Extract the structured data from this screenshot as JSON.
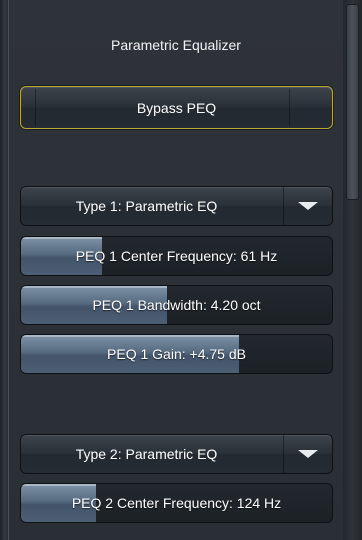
{
  "title": "Parametric Equalizer",
  "bypass_label": "Bypass PEQ",
  "peq1": {
    "type_label": "Type 1: Parametric EQ",
    "center_freq_label": "PEQ 1 Center Frequency: 61 Hz",
    "center_freq_level": 0.26,
    "bandwidth_label": "PEQ 1 Bandwidth: 4.20 oct",
    "bandwidth_level": 0.47,
    "gain_label": "PEQ 1 Gain: +4.75 dB",
    "gain_level": 0.7
  },
  "peq2": {
    "type_label": "Type 2: Parametric EQ",
    "center_freq_label": "PEQ 2 Center Frequency: 124 Hz",
    "center_freq_level": 0.24
  },
  "colors": {
    "background": "#2b3036",
    "bypass_border": "#b8a637",
    "slider_fill": "#5f7389"
  },
  "icons": {
    "dropdown": "chevron-down-icon"
  }
}
